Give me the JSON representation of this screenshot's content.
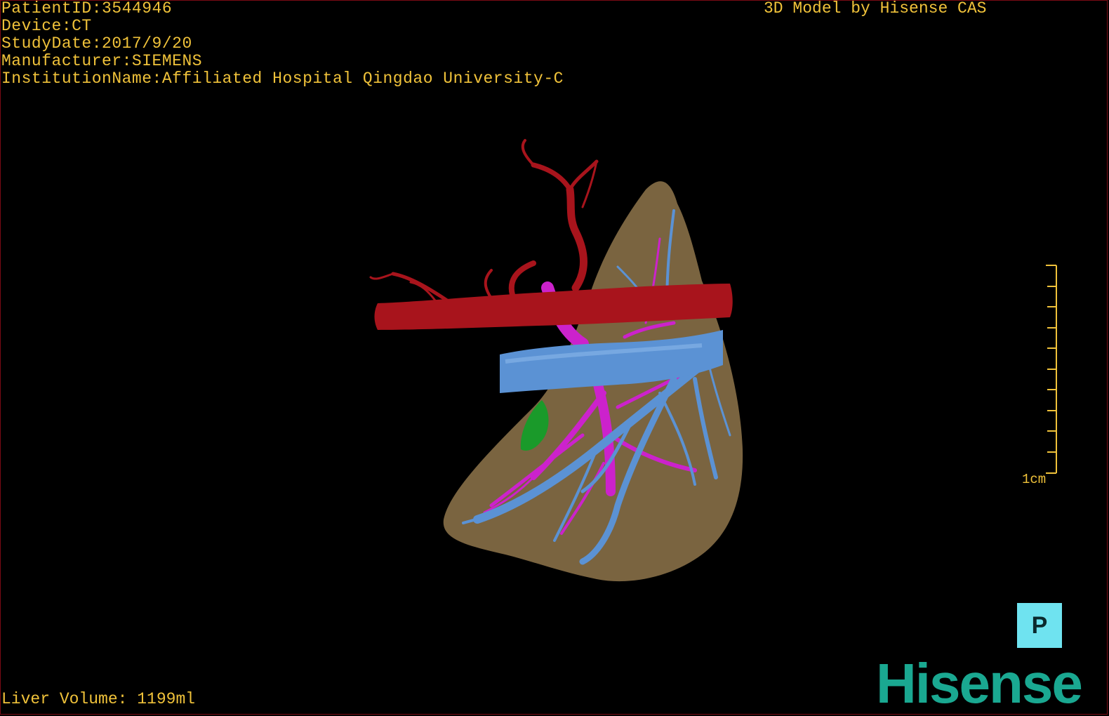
{
  "dicom_info": {
    "patient_id": "PatientID:3544946",
    "device": "Device:CT",
    "study_date": "StudyDate:2017/9/20",
    "manufacturer": "Manufacturer:SIEMENS",
    "institution": "InstitutionName:Affiliated Hospital Qingdao University-C"
  },
  "model_label": "3D Model by Hisense CAS",
  "liver_volume": "Liver Volume: 1199ml",
  "scale_bar": {
    "label": "1cm"
  },
  "orientation": {
    "label": "P",
    "icon": "orientation-cube-icon"
  },
  "brand": {
    "logo_text": "Hisense",
    "color": "#1aa891"
  },
  "colors": {
    "text": "#f0c23a",
    "liver": "#7a6440",
    "artery": "#a8141c",
    "vena_cava": "#5b92d4",
    "portal_vein": "#cc22cc",
    "gallbladder": "#1a9a2a",
    "orientation_bg": "#6fe3f0"
  },
  "structures": [
    "liver",
    "hepatic-artery",
    "inferior-vena-cava",
    "portal-vein",
    "hepatic-veins",
    "gallbladder"
  ]
}
